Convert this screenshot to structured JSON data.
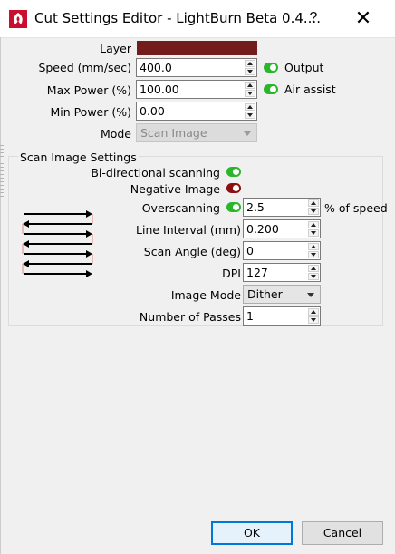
{
  "window": {
    "title": "Cut Settings Editor - LightBurn Beta 0.4....",
    "help": "?",
    "close": "✕"
  },
  "layer": {
    "label": "Layer",
    "color": "#731c1c"
  },
  "speed": {
    "label": "Speed (mm/sec)",
    "value": "400.0"
  },
  "max_power": {
    "label": "Max Power (%)",
    "value": "100.00"
  },
  "min_power": {
    "label": "Min Power (%)",
    "value": "0.00"
  },
  "mode": {
    "label": "Mode",
    "value": "Scan Image",
    "enabled": false
  },
  "output": {
    "label": "Output",
    "on": true
  },
  "air_assist": {
    "label": "Air assist",
    "on": true
  },
  "scan": {
    "group_title": "Scan Image Settings",
    "bidirectional": {
      "label": "Bi-directional scanning",
      "on": true
    },
    "negative": {
      "label": "Negative Image",
      "on": false
    },
    "overscanning": {
      "label": "Overscanning",
      "on": true,
      "value": "2.5",
      "suffix": "% of speed"
    },
    "line_interval": {
      "label": "Line Interval (mm)",
      "value": "0.200"
    },
    "scan_angle": {
      "label": "Scan Angle (deg)",
      "value": "0"
    },
    "dpi": {
      "label": "DPI",
      "value": "127"
    },
    "image_mode": {
      "label": "Image Mode",
      "value": "Dither"
    },
    "passes": {
      "label": "Number of Passes",
      "value": "1"
    }
  },
  "buttons": {
    "ok": "OK",
    "cancel": "Cancel"
  },
  "colors": {
    "toggle_on": "#2bb52b",
    "toggle_off": "#8b1010",
    "default_button_border": "#0078d7"
  }
}
